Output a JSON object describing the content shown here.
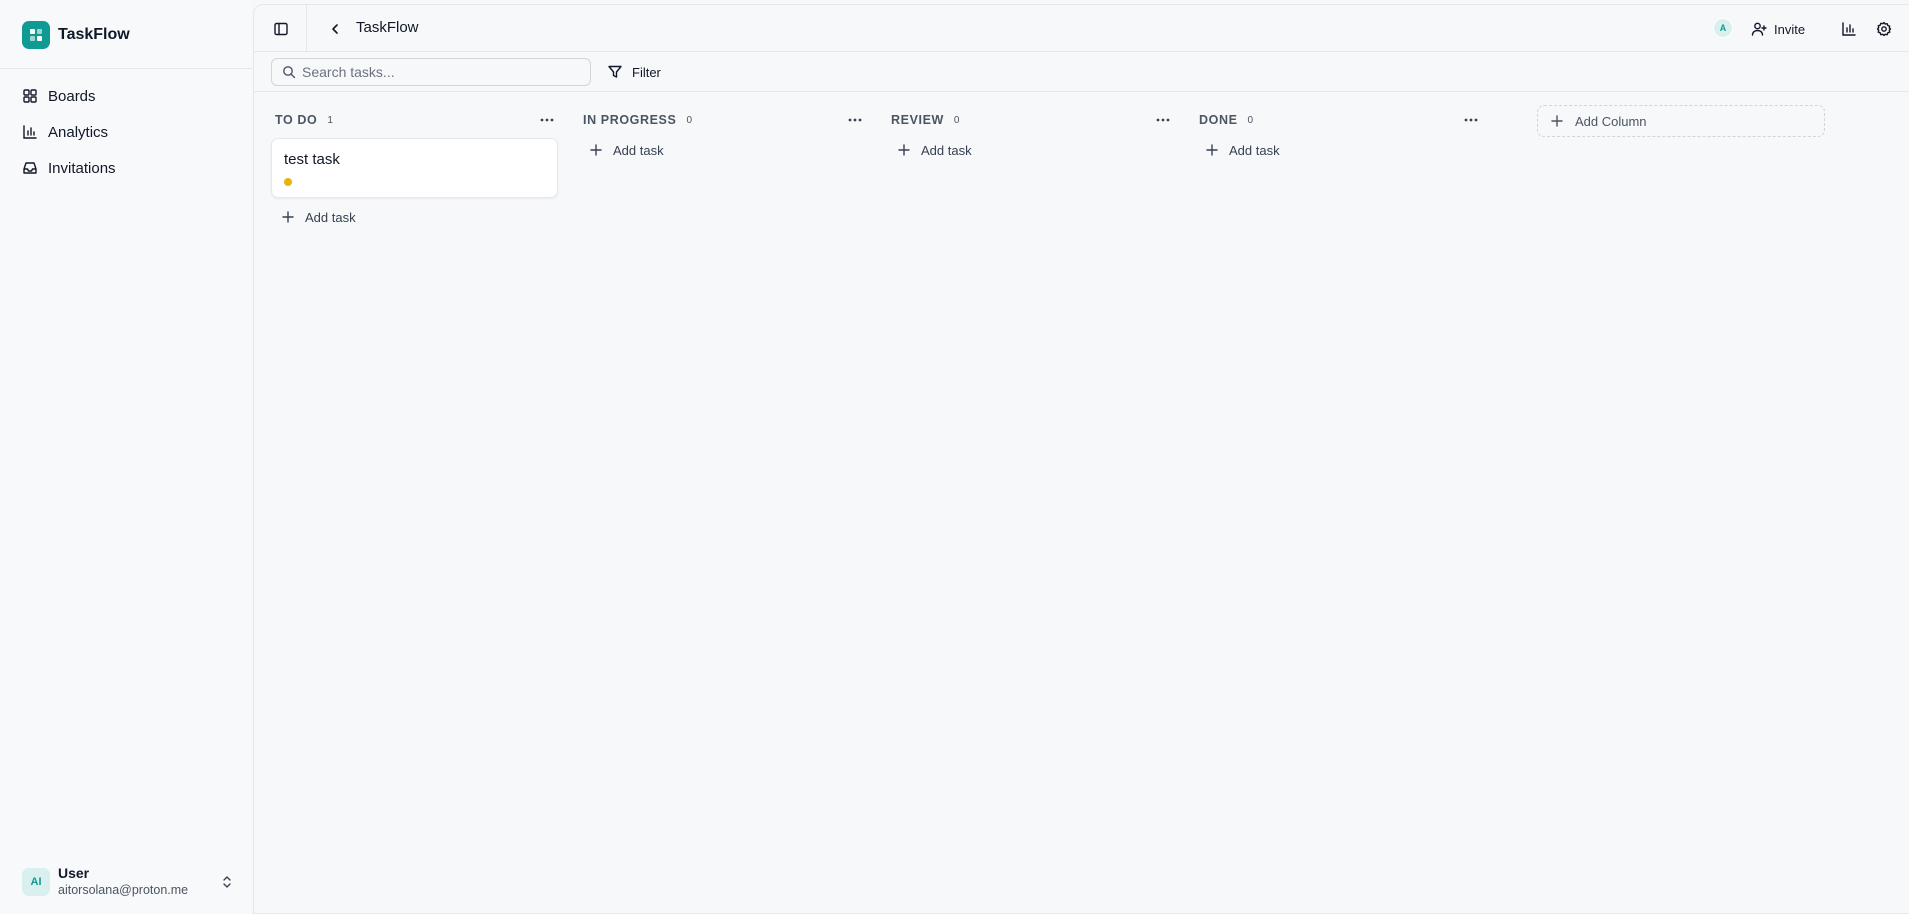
{
  "app": {
    "name": "TaskFlow"
  },
  "sidebar": {
    "items": [
      {
        "label": "Boards",
        "icon": "grid-icon"
      },
      {
        "label": "Analytics",
        "icon": "bar-chart-icon"
      },
      {
        "label": "Invitations",
        "icon": "inbox-icon"
      }
    ],
    "user": {
      "initials": "AI",
      "name": "User",
      "email": "aitorsolana@proton.me"
    }
  },
  "header": {
    "title": "TaskFlow",
    "avatar_initial": "A",
    "invite_label": "Invite"
  },
  "toolbar": {
    "search_placeholder": "Search tasks...",
    "filter_label": "Filter"
  },
  "board": {
    "add_task_label": "Add task",
    "add_column_label": "Add Column",
    "columns": [
      {
        "title": "TO DO",
        "count": "1",
        "tasks": [
          {
            "title": "test task",
            "priority_color": "#eab308"
          }
        ]
      },
      {
        "title": "IN PROGRESS",
        "count": "0",
        "tasks": []
      },
      {
        "title": "REVIEW",
        "count": "0",
        "tasks": []
      },
      {
        "title": "DONE",
        "count": "0",
        "tasks": []
      }
    ]
  },
  "colors": {
    "brand": "#0f9a94",
    "background": "#f7f8fa",
    "border": "#e5e7eb"
  }
}
